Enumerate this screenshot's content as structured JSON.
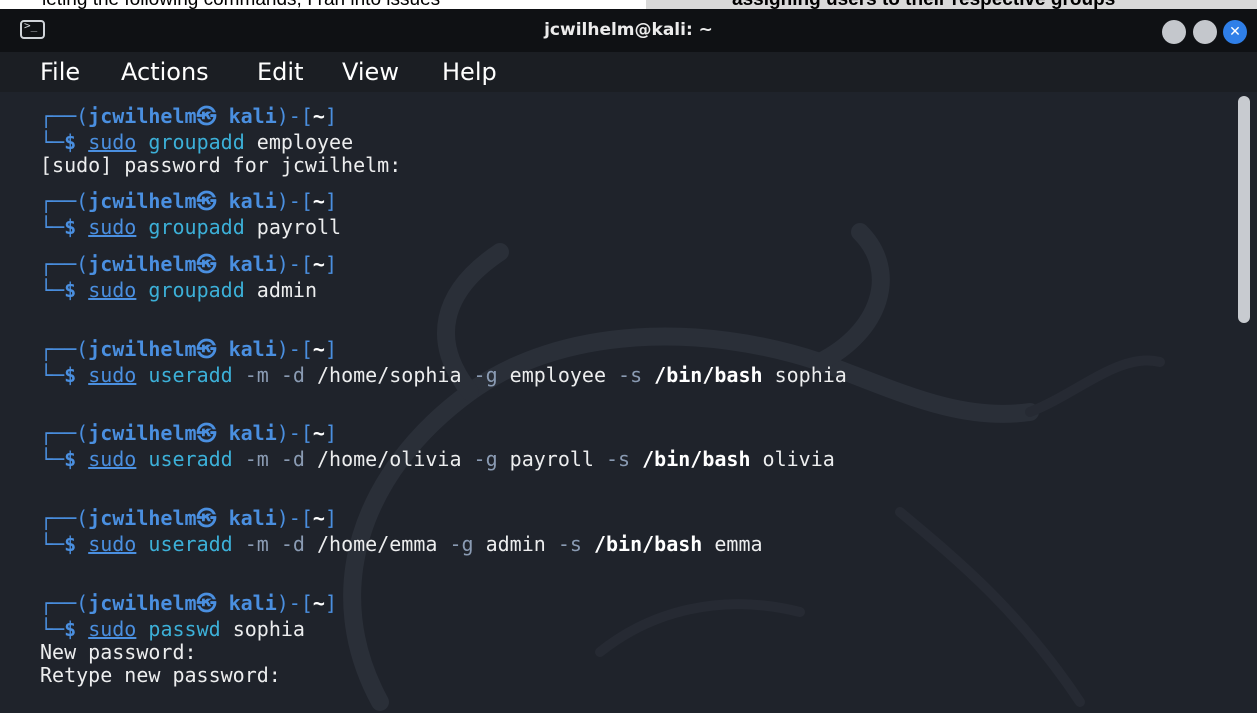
{
  "document": {
    "text_left": "leting the following commands, I ran into issues",
    "text_right": "assigning users to their respective groups"
  },
  "window": {
    "title": "jcwilhelm@kali: ~",
    "close_glyph": "✕"
  },
  "menu": {
    "file": "File",
    "actions": "Actions",
    "edit": "Edit",
    "view": "View",
    "help": "Help"
  },
  "prompt": {
    "open": "┌──(",
    "user": "jcwilhelm",
    "at": "㉿",
    "host": "kali",
    "close_paren": ")-[",
    "dir": "~",
    "close_bracket": "]",
    "corner": "└─",
    "dollar": "$"
  },
  "commands": [
    {
      "sudo": "sudo",
      "cmd": "groupadd",
      "rest_plain": " employee",
      "output": [
        "[sudo] password for jcwilhelm:"
      ]
    },
    {
      "sudo": "sudo",
      "cmd": "groupadd",
      "rest_plain": " payroll",
      "output": []
    },
    {
      "sudo": "sudo",
      "cmd": "groupadd",
      "rest_plain": " admin",
      "output": []
    },
    {
      "sudo": "sudo",
      "cmd": "useradd",
      "opt1": " -m -d",
      "path": " /home/sophia",
      "opt2": " -g",
      "group": " employee",
      "opt3": " -s",
      "shell": " /bin/bash",
      "user": " sophia",
      "output": []
    },
    {
      "sudo": "sudo",
      "cmd": "useradd",
      "opt1": " -m -d",
      "path": " /home/olivia",
      "opt2": " -g",
      "group": " payroll",
      "opt3": " -s",
      "shell": " /bin/bash",
      "user": " olivia",
      "output": []
    },
    {
      "sudo": "sudo",
      "cmd": "useradd",
      "opt1": " -m -d",
      "path": " /home/emma",
      "opt2": " -g",
      "group": " admin",
      "opt3": " -s",
      "shell": " /bin/bash",
      "user": " emma",
      "output": []
    },
    {
      "sudo": "sudo",
      "cmd": "passwd",
      "rest_plain": " sophia",
      "output": [
        "New password:",
        "Retype new password:"
      ]
    }
  ],
  "colors": {
    "terminal_bg": "#1f232b",
    "titlebar_bg": "#0f1114",
    "prompt_blue": "#4a8fe0",
    "cmd_cyan": "#3cb0d8",
    "close_button": "#2f7fe8"
  }
}
